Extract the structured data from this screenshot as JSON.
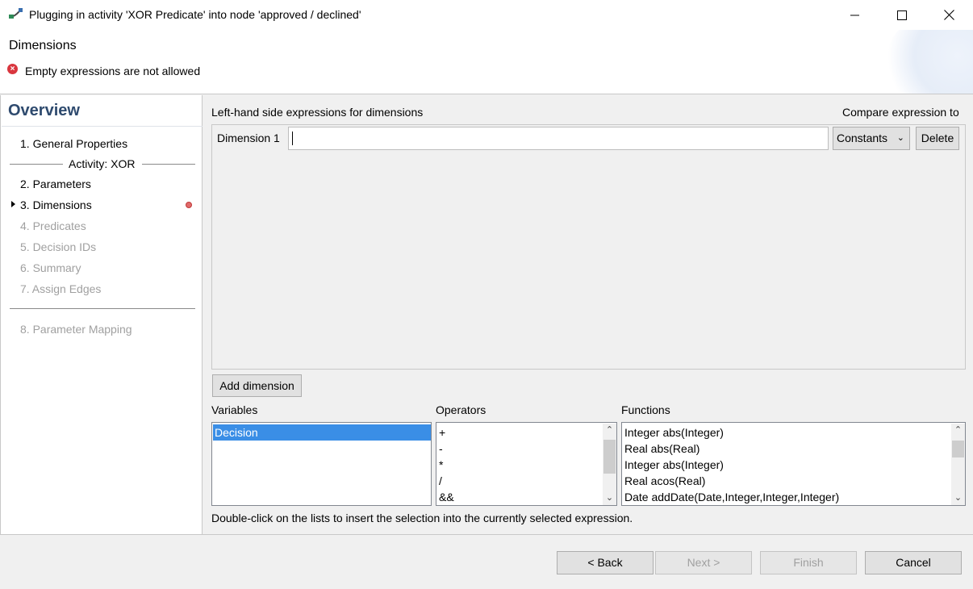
{
  "window": {
    "title": "Plugging in activity 'XOR Predicate' into node 'approved / declined'",
    "icon": "plug-activity-icon",
    "controls": {
      "minimize": "minimize-icon",
      "maximize": "maximize-icon",
      "close": "close-icon"
    }
  },
  "header": {
    "title": "Dimensions",
    "error_message": "Empty expressions are not allowed",
    "error_icon_glyph": "×"
  },
  "overview": {
    "title": "Overview",
    "items": [
      {
        "label": "1. General Properties",
        "enabled": true
      },
      {
        "label": "2. Parameters",
        "enabled": true
      },
      {
        "label": "3. Dimensions",
        "enabled": true,
        "current": true,
        "has_error": true
      },
      {
        "label": "4. Predicates",
        "enabled": false
      },
      {
        "label": "5. Decision IDs",
        "enabled": false
      },
      {
        "label": "6. Summary",
        "enabled": false
      },
      {
        "label": "7. Assign Edges",
        "enabled": false
      },
      {
        "label": "8. Parameter Mapping",
        "enabled": false
      }
    ],
    "group_label": "Activity: XOR"
  },
  "main": {
    "lhs_label": "Left-hand side expressions for dimensions",
    "compare_label": "Compare expression to",
    "dimension": {
      "label": "Dimension 1",
      "value": "",
      "compare_selected": "Constants",
      "delete_label": "Delete"
    },
    "add_dimension_label": "Add dimension",
    "variables": {
      "label": "Variables",
      "items": [
        "Decision"
      ],
      "selected": "Decision"
    },
    "operators": {
      "label": "Operators",
      "items": [
        "+",
        "-",
        "*",
        "/",
        "&&"
      ]
    },
    "functions": {
      "label": "Functions",
      "items": [
        "Integer abs(Integer)",
        "Real abs(Real)",
        "Integer abs(Integer)",
        "Real acos(Real)",
        "Date addDate(Date,Integer,Integer,Integer)"
      ]
    },
    "hint": "Double-click on the lists to insert the selection into the currently selected expression."
  },
  "footer": {
    "back": "< Back",
    "next": "Next >",
    "finish": "Finish",
    "cancel": "Cancel"
  },
  "colors": {
    "selection": "#3a8ee6",
    "overview_title": "#2e4a6e",
    "error": "#d9363e"
  }
}
